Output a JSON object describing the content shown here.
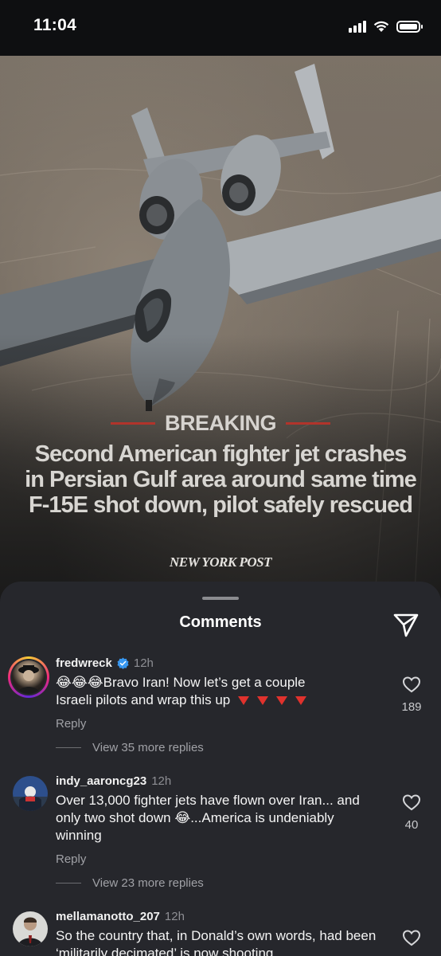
{
  "status_bar": {
    "time": "11:04"
  },
  "post": {
    "breaking": "BREAKING",
    "headline": "Second American fighter jet crashes in Persian Gulf area around same time F-15E shot down, pilot safely rescued",
    "publisher": "NEW YORK POST"
  },
  "sheet": {
    "title": "Comments"
  },
  "comments": [
    {
      "username": "fredwreck",
      "verified": true,
      "time": "12h",
      "text_line1": "Bravo Iran! Now let’s get a couple",
      "text_line2": "Israeli pilots and wrap this up",
      "emoji": "😂",
      "reply": "Reply",
      "likes": "189",
      "more_replies": "View 35 more replies"
    },
    {
      "username": "indy_aaroncg23",
      "time": "12h",
      "text_part1": "Over 13,000 fighter jets have flown over Iran... and only two shot down",
      "emoji": "😂",
      "text_part2": "...America is undeniably winning",
      "reply": "Reply",
      "likes": "40",
      "more_replies": "View 23 more replies"
    },
    {
      "username": "mellamanotto_207",
      "time": "12h",
      "text": "So the country that, in Donald’s own words, had been ‘militarily decimated’ is now shooting"
    }
  ],
  "colors": {
    "sheet_bg": "#26272c",
    "breaking_red": "#b1342b",
    "verified_blue": "#3897f0"
  },
  "icons": [
    "signal-icon",
    "wifi-icon",
    "battery-icon",
    "share-icon",
    "heart-icon",
    "verified-icon"
  ]
}
